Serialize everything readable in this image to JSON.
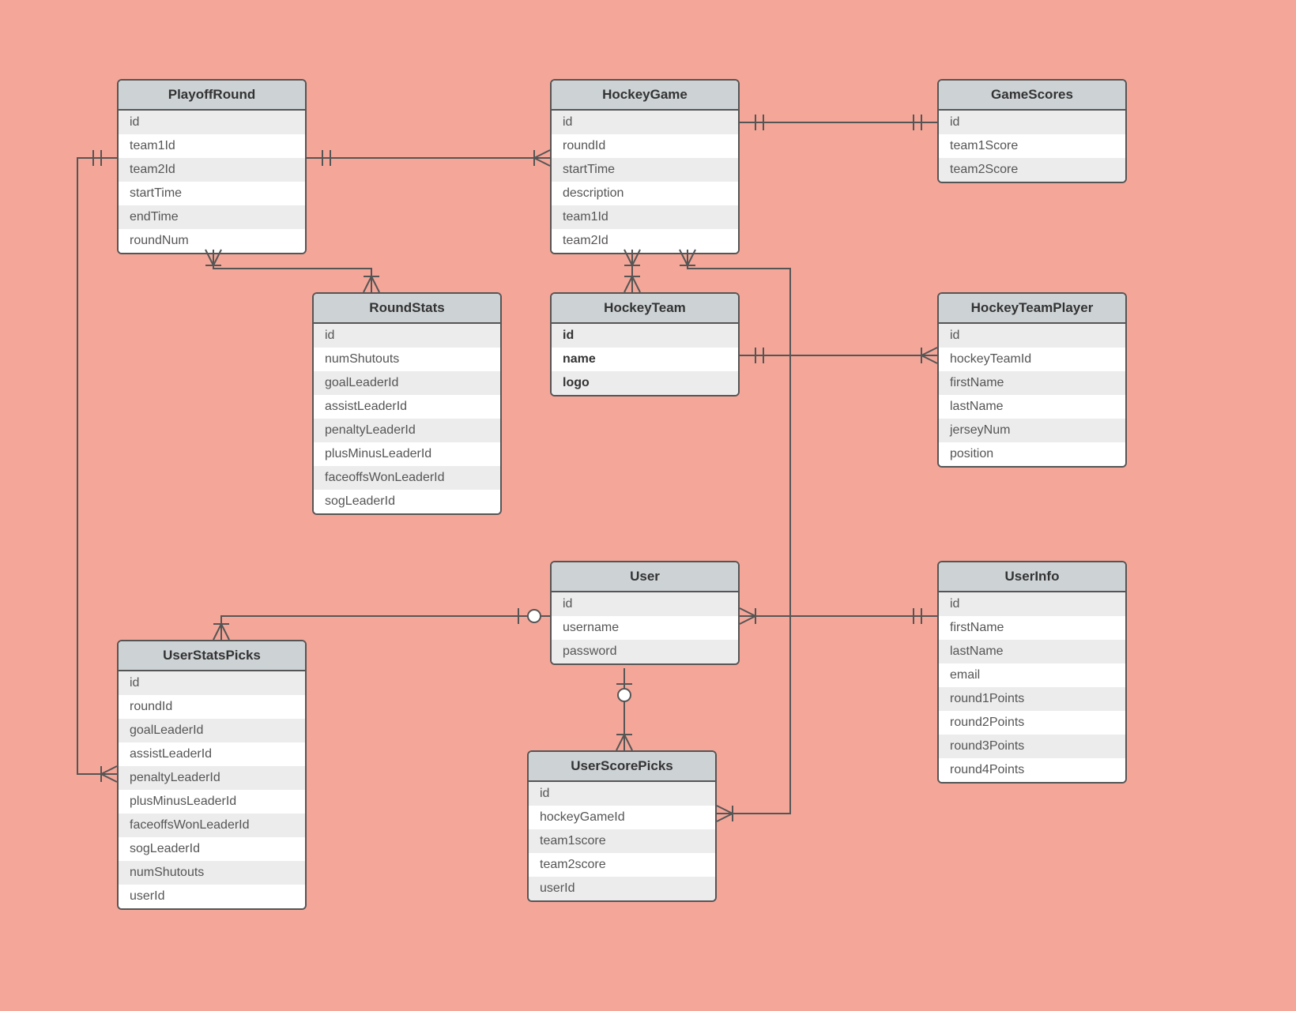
{
  "entities": {
    "playoffRound": {
      "title": "PlayoffRound",
      "fields": [
        "id",
        "team1Id",
        "team2Id",
        "startTime",
        "endTime",
        "roundNum"
      ]
    },
    "hockeyGame": {
      "title": "HockeyGame",
      "fields": [
        "id",
        "roundId",
        "startTime",
        "description",
        "team1Id",
        "team2Id"
      ]
    },
    "gameScores": {
      "title": "GameScores",
      "fields": [
        "id",
        "team1Score",
        "team2Score"
      ]
    },
    "roundStats": {
      "title": "RoundStats",
      "fields": [
        "id",
        "numShutouts",
        "goalLeaderId",
        "assistLeaderId",
        "penaltyLeaderId",
        "plusMinusLeaderId",
        "faceoffsWonLeaderId",
        "sogLeaderId"
      ]
    },
    "hockeyTeam": {
      "title": "HockeyTeam",
      "fields": [
        "id",
        "name",
        "logo"
      ],
      "bold": true
    },
    "hockeyTeamPlayer": {
      "title": "HockeyTeamPlayer",
      "fields": [
        "id",
        "hockeyTeamId",
        "firstName",
        "lastName",
        "jerseyNum",
        "position"
      ]
    },
    "user": {
      "title": "User",
      "fields": [
        "id",
        "username",
        "password"
      ]
    },
    "userInfo": {
      "title": "UserInfo",
      "fields": [
        "id",
        "firstName",
        "lastName",
        "email",
        "round1Points",
        "round2Points",
        "round3Points",
        "round4Points"
      ]
    },
    "userStatsPicks": {
      "title": "UserStatsPicks",
      "fields": [
        "id",
        "roundId",
        "goalLeaderId",
        "assistLeaderId",
        "penaltyLeaderId",
        "plusMinusLeaderId",
        "faceoffsWonLeaderId",
        "sogLeaderId",
        "numShutouts",
        "userId"
      ]
    },
    "userScorePicks": {
      "title": "UserScorePicks",
      "fields": [
        "id",
        "hockeyGameId",
        "team1score",
        "team2score",
        "userId"
      ]
    }
  }
}
